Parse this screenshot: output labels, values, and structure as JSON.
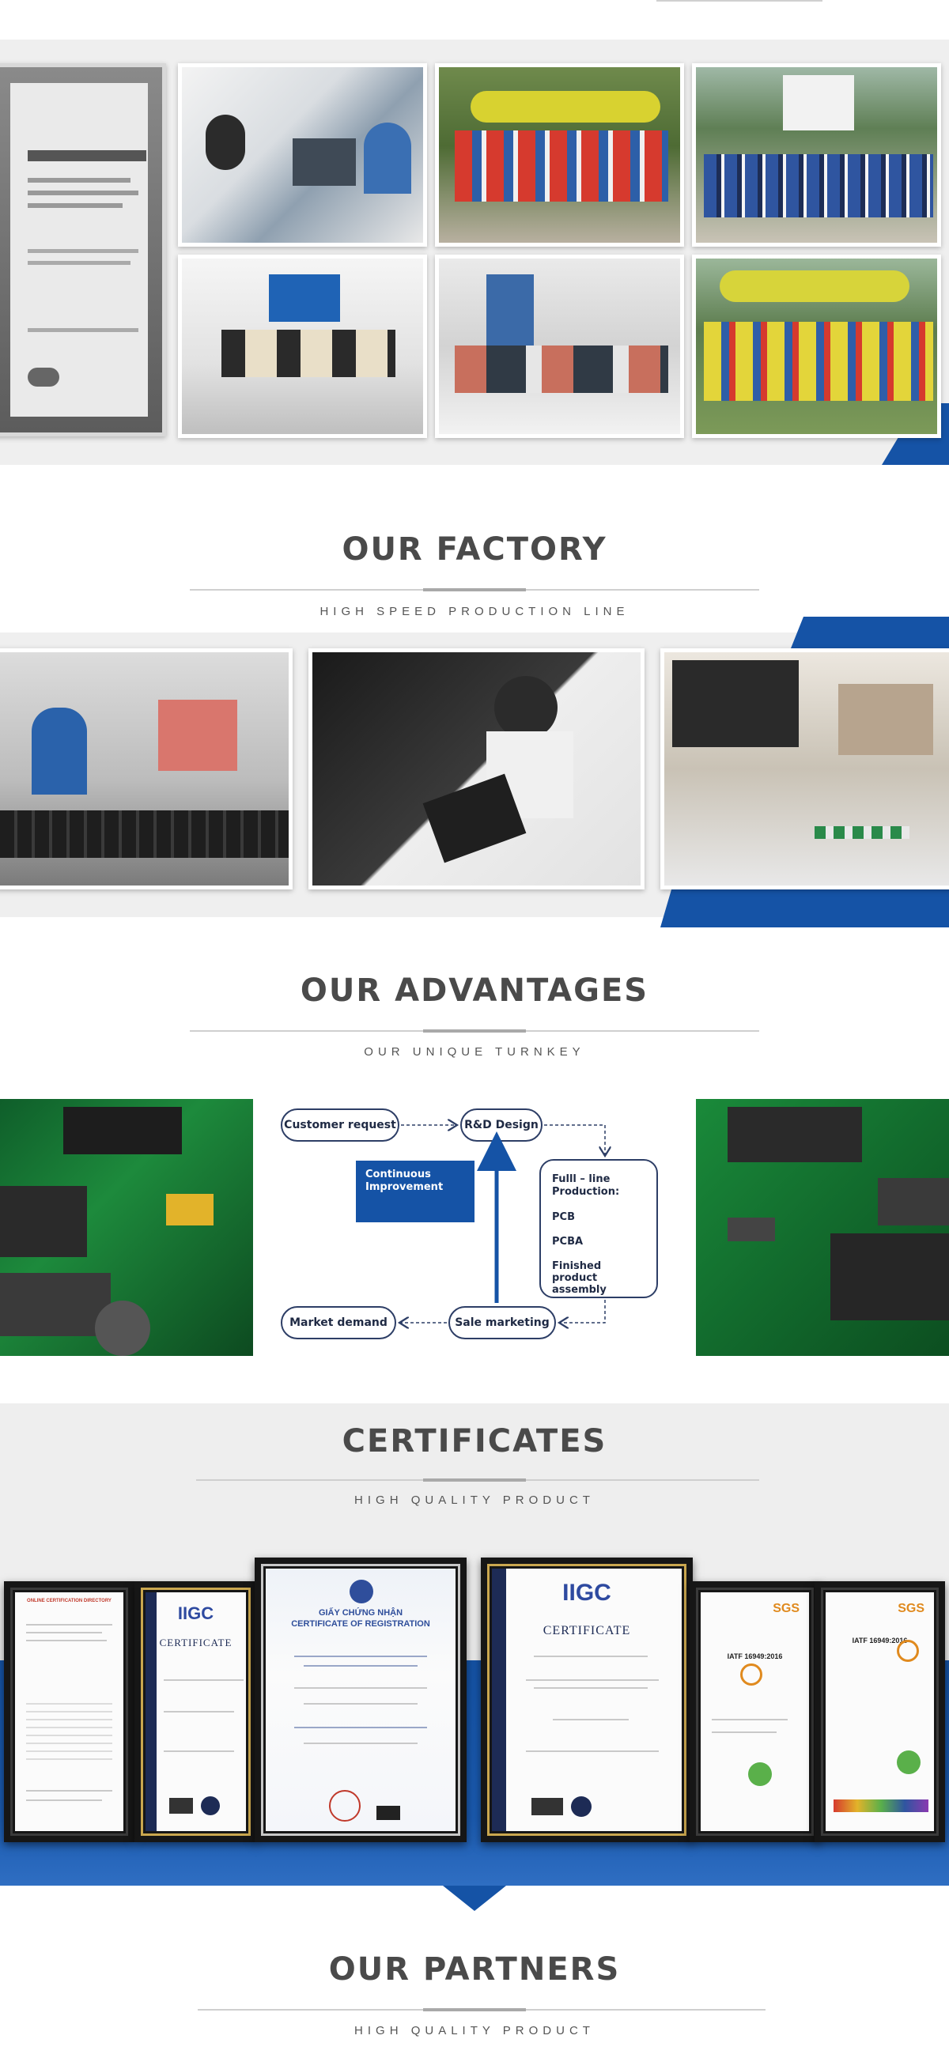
{
  "factory": {
    "title": "OUR FACTORY",
    "subtitle": "HIGH SPEED PRODUCTION LINE"
  },
  "advantages": {
    "title": "OUR ADVANTAGES",
    "subtitle": "OUR UNIQUE TURNKEY",
    "flow": {
      "customer_request": "Customer request",
      "rd_design": "R&D Design",
      "continuous_improvement": "Continuous Improvement",
      "full_line_production": "Fulll – line Production:",
      "pcb": "PCB",
      "pcba": "PCBA",
      "finished_product": "Finished product assembly",
      "sale_marketing": "Sale marketing",
      "market_demand": "Market demand"
    }
  },
  "certificates": {
    "title": "CERTIFICATES",
    "subtitle": "HIGH QUALITY PRODUCT",
    "items": [
      {
        "heading": "ONLINE CERTIFICATION DIRECTORY"
      },
      {
        "heading": "IIGC",
        "sub": "CERTIFICATE"
      },
      {
        "heading": "GIẤY CHỨNG NHẬN",
        "sub": "CERTIFICATE OF REGISTRATION"
      },
      {
        "heading": "IIGC",
        "sub": "CERTIFICATE"
      },
      {
        "heading": "SGS",
        "sub": "IATF 16949:2016"
      },
      {
        "heading": "SGS",
        "sub": "IATF 16949:2016"
      }
    ]
  },
  "partners": {
    "title": "OUR PARTNERS",
    "subtitle": "HIGH QUALITY PRODUCT"
  },
  "colors": {
    "brand_blue": "#1553a6",
    "heading_gray": "#4a4a4a",
    "band_gray": "#efefef"
  }
}
